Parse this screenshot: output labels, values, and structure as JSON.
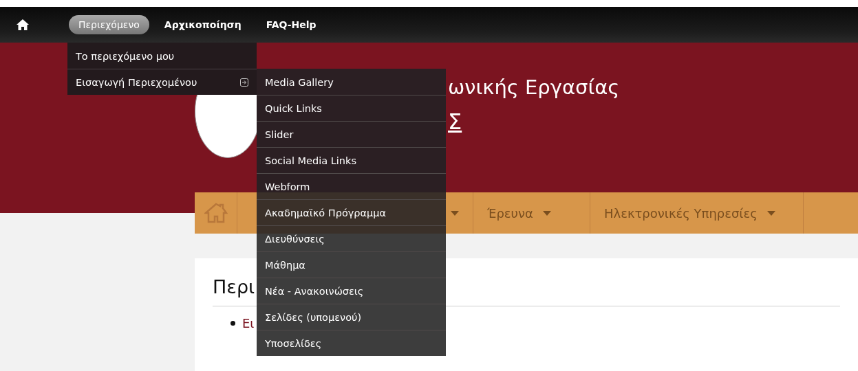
{
  "toolbar": {
    "items": [
      {
        "label": "Περιεχόμενο",
        "selected": true
      },
      {
        "label": "Αρχικοποίηση",
        "selected": false
      },
      {
        "label": "FAQ-Help",
        "selected": false
      }
    ]
  },
  "dropdown": {
    "items": [
      {
        "label": "Το περιεχόμενο μου",
        "has_submenu": false
      },
      {
        "label": "Εισαγωγή Περιεχομένου",
        "has_submenu": true
      }
    ]
  },
  "submenu": {
    "items": [
      "Media Gallery",
      "Quick Links",
      "Slider",
      "Social Media Links",
      "Webform",
      "Ακαδημαϊκό Πρόγραμμα",
      "Διευθύνσεις",
      "Μάθημα",
      "Νέα - Ανακοινώσεις",
      "Σελίδες (υπομενού)",
      "Υποσελίδες"
    ]
  },
  "header": {
    "site_name": "ωνικής Εργασίας",
    "site_slogan": "Σ"
  },
  "main_nav": {
    "items": [
      {
        "dropdown": false
      },
      {
        "dropdown": true
      },
      {
        "label": "Έρευνα",
        "dropdown": true
      },
      {
        "label": "Ηλεκτρονικές Υπηρεσίες",
        "dropdown": true
      }
    ]
  },
  "content": {
    "title": "Περι",
    "links": [
      "Ει"
    ]
  }
}
